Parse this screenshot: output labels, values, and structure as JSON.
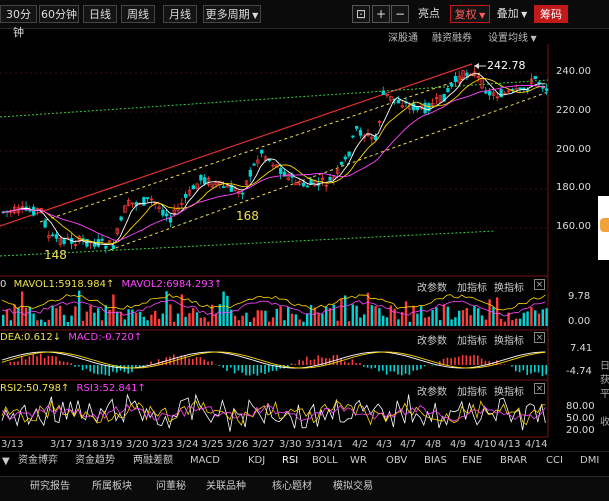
{
  "toolbar": {
    "periods": [
      "30分钟",
      "60分钟",
      "日线",
      "周线",
      "月线"
    ],
    "more_periods": "更多周期",
    "mode_labels": [
      "亮点",
      "复权",
      "叠加",
      "筹码"
    ],
    "icon_names": [
      "crosshair-icon",
      "plus-icon",
      "minus-icon"
    ]
  },
  "subbar": {
    "links": [
      "深股通",
      "融资融券",
      "设置均线"
    ]
  },
  "price_axis": {
    "labels": [
      "240.00",
      "220.00",
      "200.00",
      "180.00",
      "160.00"
    ]
  },
  "annotations": {
    "high": "242.78",
    "low1": "148",
    "low2": "168"
  },
  "panes": {
    "vol": {
      "label": "0",
      "mavol1": "MAVOL1:5918.984",
      "mavol2": "MAVOL2:6984.293",
      "arrow": "↑",
      "axis": [
        "9.78",
        "0.00"
      ]
    },
    "macd": {
      "dea": "DEA:0.612",
      "dea_arrow": "↓",
      "macd": "MACD:-0.720",
      "macd_arrow": "↑",
      "axis": [
        "7.41",
        "-4.74"
      ]
    },
    "rsi": {
      "rsi2": "RSI2:50.798",
      "rsi2_arrow": "↑",
      "rsi3": "RSI3:52.841",
      "rsi3_arrow": "↑",
      "axis": [
        "80.00",
        "50.00",
        "20.00"
      ]
    }
  },
  "pane_actions": [
    "改参数",
    "加指标",
    "换指标"
  ],
  "close_glyph": "×",
  "dates": [
    "3/13",
    "3/17",
    "3/18",
    "3/19",
    "3/20",
    "3/23",
    "3/24",
    "3/25",
    "3/26",
    "3/27",
    "3/30",
    "3/31",
    "4/1",
    "4/2",
    "4/3",
    "4/7",
    "4/8",
    "4/9",
    "4/10",
    "4/13",
    "4/14"
  ],
  "indicator_tabs": [
    "资金博弈",
    "资金趋势",
    "两融差额",
    "MACD",
    "KDJ",
    "RSI",
    "BOLL",
    "WR",
    "OBV",
    "BIAS",
    "ENE",
    "BRAR",
    "CCI",
    "DMI"
  ],
  "active_indicator": "RSI",
  "bottom_tabs": [
    "研究报告",
    "所属板块",
    "问董秘",
    "关联品种",
    "核心题材",
    "模拟交易"
  ],
  "right_side_fragments": [
    "日",
    "获",
    "平",
    "收"
  ],
  "colors": {
    "up": "#ff3b3b",
    "down": "#00d4d4",
    "ma1": "#ffffff",
    "ma2": "#ffd700",
    "ma3": "#ff44ff",
    "trend_red": "#e03030",
    "trend_yellow": "#f0e050",
    "trend_green": "#3cd03c",
    "active": "#c21a1a"
  }
}
